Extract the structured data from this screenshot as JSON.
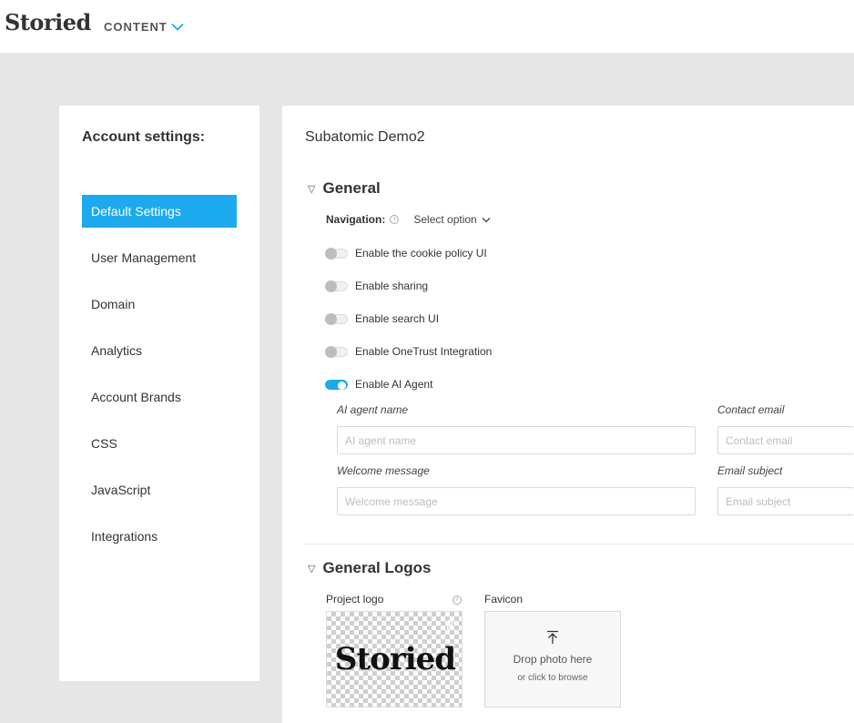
{
  "header": {
    "logo": "Storied",
    "content_menu": "CONTENT"
  },
  "sidebar": {
    "title": "Account settings:",
    "items": [
      {
        "label": "Default Settings",
        "active": true
      },
      {
        "label": "User Management"
      },
      {
        "label": "Domain"
      },
      {
        "label": "Analytics"
      },
      {
        "label": "Account Brands"
      },
      {
        "label": "CSS"
      },
      {
        "label": "JavaScript"
      },
      {
        "label": "Integrations"
      }
    ]
  },
  "main": {
    "project_name": "Subatomic Demo2",
    "general": {
      "title": "General",
      "navigation_label": "Navigation:",
      "navigation_value": "Select option",
      "toggles": [
        {
          "label": "Enable the cookie policy UI",
          "on": false
        },
        {
          "label": "Enable sharing",
          "on": false
        },
        {
          "label": "Enable search UI",
          "on": false
        },
        {
          "label": "Enable OneTrust Integration",
          "on": false
        },
        {
          "label": "Enable AI Agent",
          "on": true
        }
      ],
      "fields": {
        "agent_name": {
          "label": "AI agent name",
          "placeholder": "AI agent name",
          "value": ""
        },
        "contact_email": {
          "label": "Contact email",
          "placeholder": "Contact email",
          "value": ""
        },
        "welcome_message": {
          "label": "Welcome message",
          "placeholder": "Welcome message",
          "value": ""
        },
        "email_subject": {
          "label": "Email subject",
          "placeholder": "Email subject",
          "value": ""
        }
      }
    },
    "logos": {
      "title": "General Logos",
      "project_logo_label": "Project logo",
      "project_logo_text": "Storied",
      "favicon_label": "Favicon",
      "drop_title": "Drop photo here",
      "drop_sub": "or click to browse"
    }
  },
  "colors": {
    "accent": "#1ca9ed",
    "page_bg": "#e6e6e6"
  }
}
